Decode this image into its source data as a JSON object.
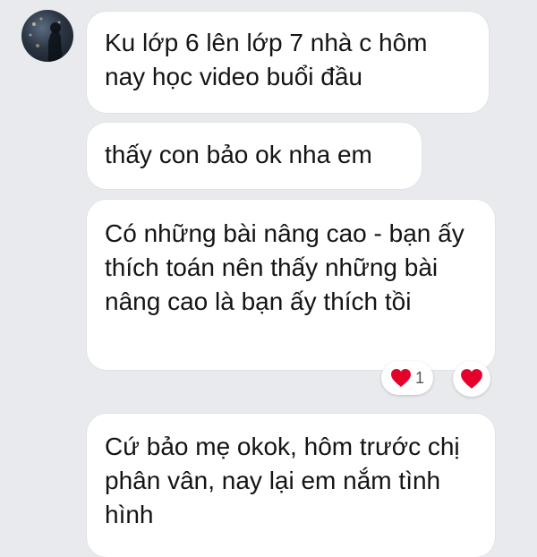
{
  "messages": [
    {
      "text": "Ku lớp 6 lên lớp 7 nhà c hôm nay học video buổi đầu"
    },
    {
      "text": "thấy con bảo ok nha em"
    },
    {
      "text": "Có những bài nâng cao - bạn ấy thích toán nên thấy những bài nâng cao là bạn ấy thích tồi"
    },
    {
      "text": "Cứ bảo mẹ okok, hôm trước chị phân vân, nay lại em nắm tình hình"
    }
  ],
  "reaction": {
    "icon": "heart-icon",
    "count": "1",
    "color": "#e4002b"
  },
  "react_button": {
    "icon": "heart-icon"
  }
}
